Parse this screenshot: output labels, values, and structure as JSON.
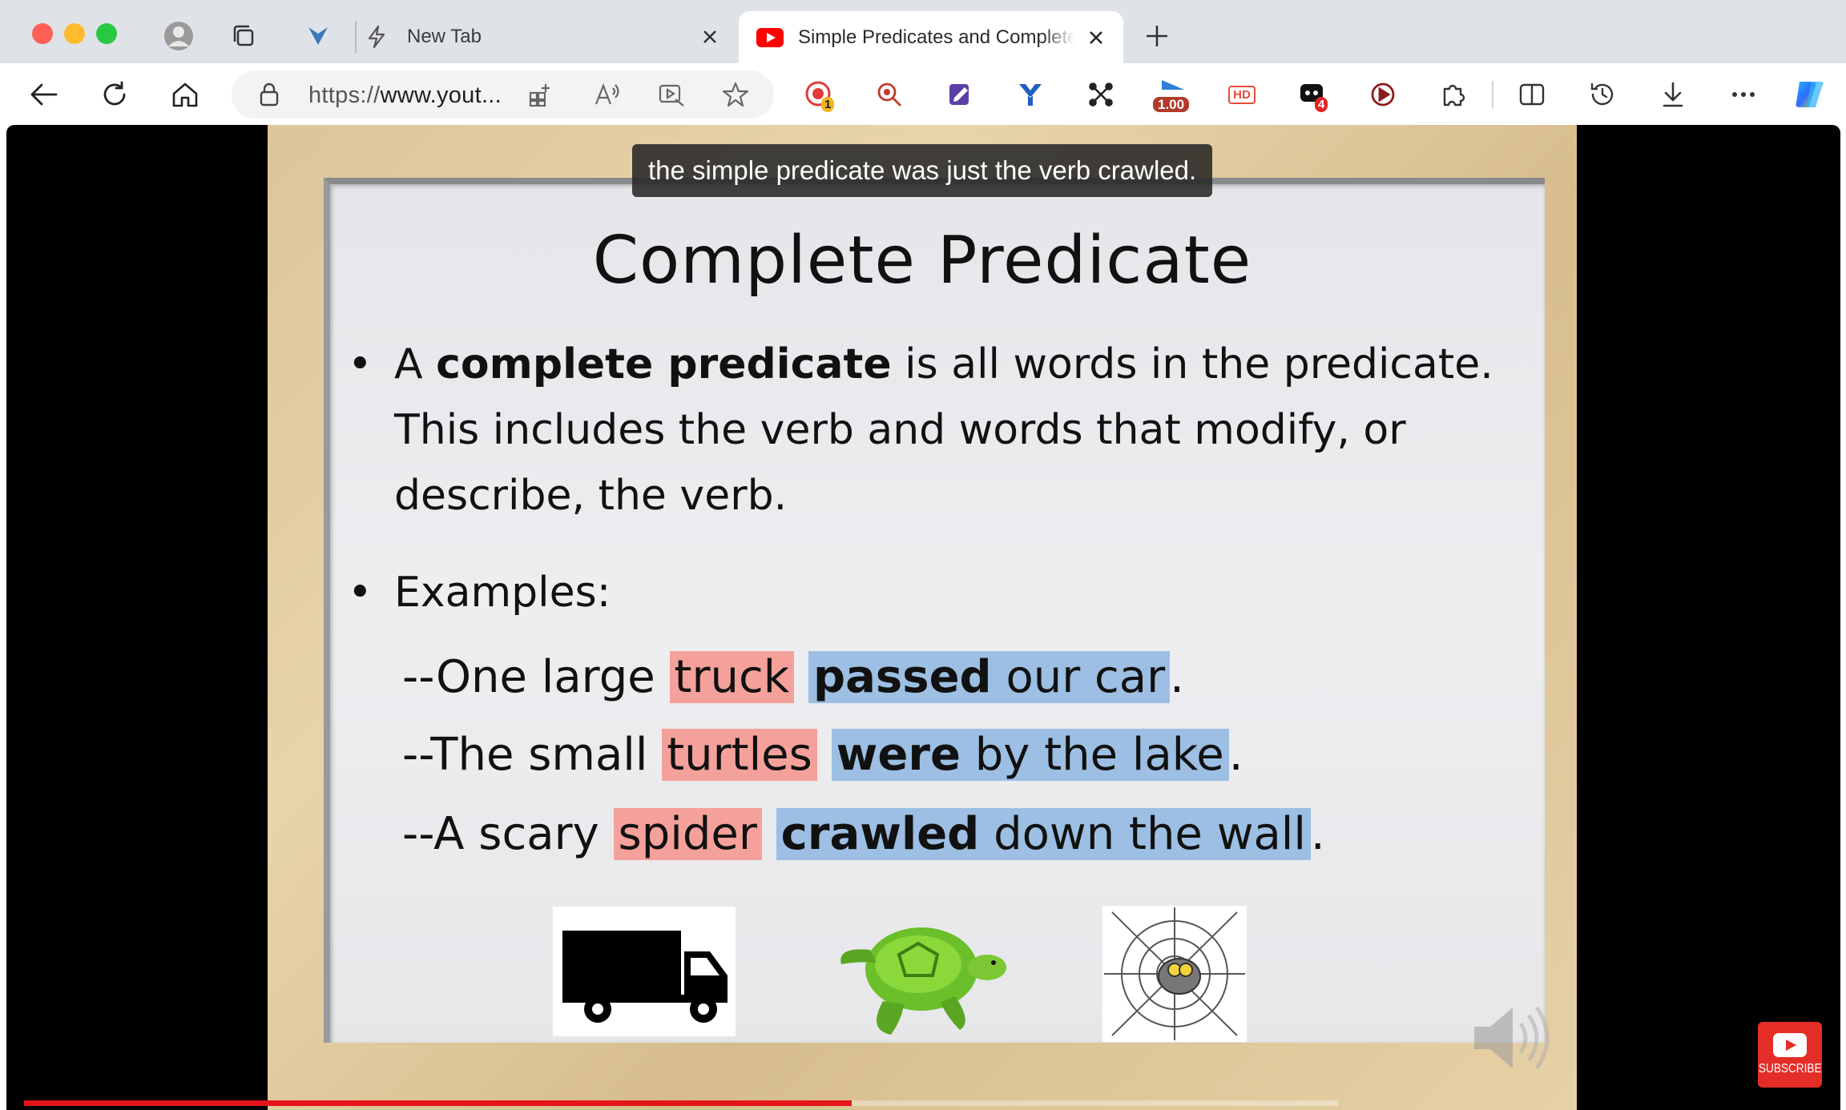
{
  "window": {
    "traffic_lights": {
      "close": "#ff5f57",
      "minimize": "#febc2e",
      "maximize": "#28c840"
    }
  },
  "tabs": [
    {
      "title": "New Tab",
      "active": false,
      "icon": "lightning-icon"
    },
    {
      "title": "Simple Predicates and Complete",
      "active": true,
      "icon": "youtube-icon"
    }
  ],
  "address_bar": {
    "url_scheme": "https://",
    "url_host": "www.yout..."
  },
  "extensions": {
    "badge_1": "1",
    "speed_badge": "1.00",
    "hd_label": "HD",
    "badge_4": "4"
  },
  "video": {
    "caption": "the simple predicate was just the verb crawled.",
    "slide": {
      "title": "Complete Predicate",
      "bullet1_prefix": "A ",
      "bullet1_bold": "complete predicate",
      "bullet1_rest": " is all words in the predicate.",
      "bullet1_line2": "This includes the verb and words that modify, or",
      "bullet1_line3": "describe, the verb.",
      "bullet2": "Examples:",
      "examples": [
        {
          "prefix": "--One large ",
          "subject": "truck",
          "verb": "passed",
          "rest": " our car",
          "end": "."
        },
        {
          "prefix": "--The small ",
          "subject": "turtles",
          "verb": "were",
          "rest": " by the lake",
          "end": "."
        },
        {
          "prefix": "--A scary ",
          "subject": "spider",
          "verb": "crawled",
          "rest": " down the wall",
          "end": "."
        }
      ]
    },
    "subscribe_label": "SUBSCRIBE",
    "progress": 0.63,
    "colors": {
      "subject_highlight": "#f5a19b",
      "predicate_highlight": "#9cbfe3",
      "progress": "#e3161b"
    }
  }
}
